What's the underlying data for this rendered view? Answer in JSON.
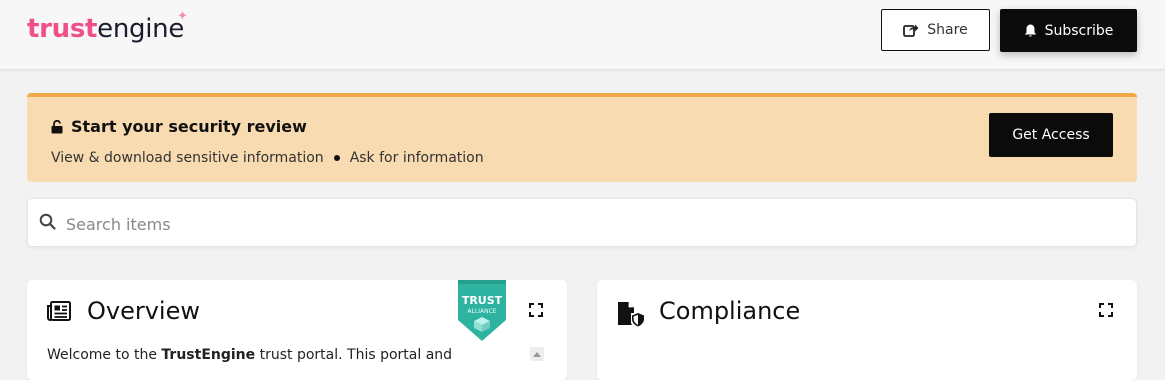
{
  "header": {
    "logo_part1": "trust",
    "logo_part2": "engine",
    "share_label": "Share",
    "subscribe_label": "Subscribe"
  },
  "banner": {
    "title": "Start your security review",
    "item1": "View & download sensitive information",
    "item2": "Ask for information",
    "access_label": "Get Access"
  },
  "search": {
    "placeholder": "Search items"
  },
  "overview": {
    "title": "Overview",
    "text_prefix": "Welcome to the ",
    "text_brand": "TrustEngine",
    "text_suffix": " trust portal. This portal and",
    "badge_line1": "TRUST",
    "badge_line2": "ALLIANCE"
  },
  "compliance": {
    "title": "Compliance"
  },
  "colors": {
    "accent": "#f0508a",
    "banner_bg": "#f8dbb0",
    "banner_border": "#f0a848",
    "badge": "#2eb3a0"
  }
}
